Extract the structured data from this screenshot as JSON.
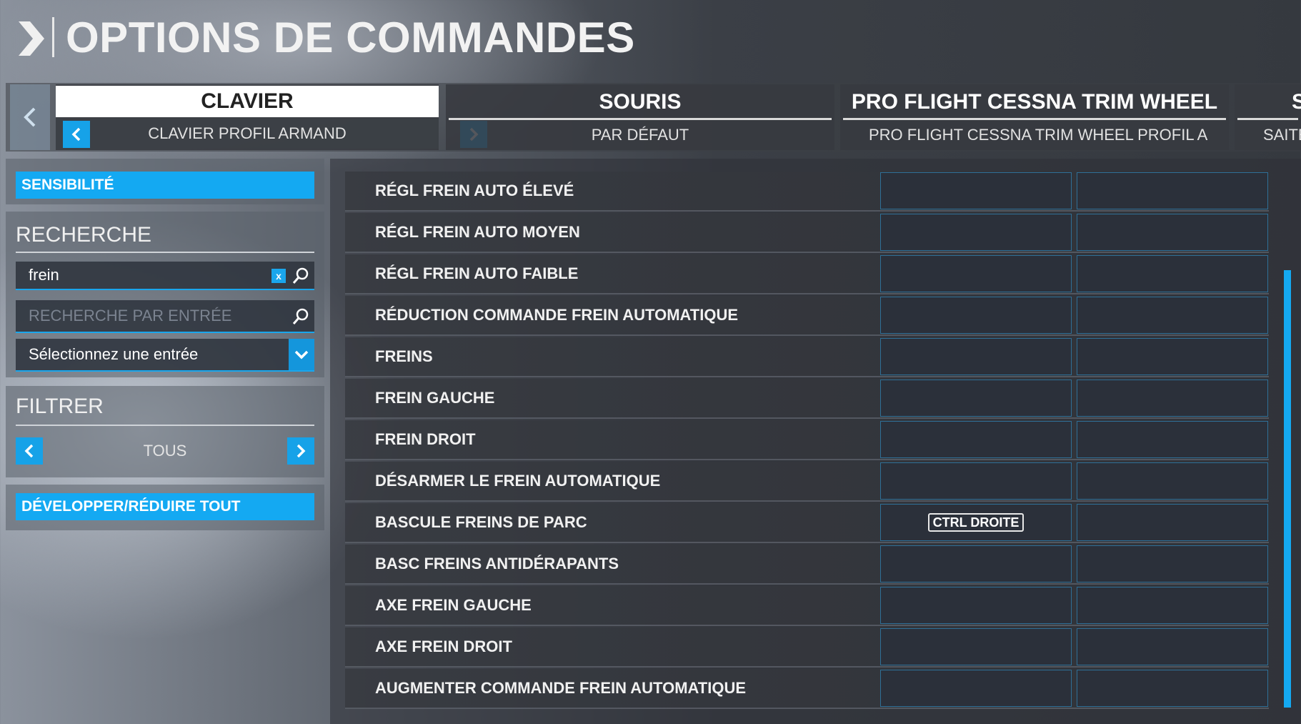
{
  "header": {
    "title": "OPTIONS DE COMMANDES"
  },
  "device_tabs": [
    {
      "name": "CLAVIER",
      "profile": "CLAVIER PROFIL ARMAND",
      "active": true
    },
    {
      "name": "SOURIS",
      "profile": "PAR DÉFAUT",
      "active": false
    },
    {
      "name": "PRO FLIGHT CESSNA TRIM WHEEL",
      "profile": "PRO FLIGHT CESSNA TRIM WHEEL PROFIL A",
      "active": false
    },
    {
      "name": "S",
      "profile": "SAITE",
      "active": false
    }
  ],
  "sidebar": {
    "sensitivity_label": "SENSIBILITÉ",
    "search": {
      "title": "RECHERCHE",
      "query_value": "frein",
      "clear_label": "x",
      "input_search_placeholder": "RECHERCHE PAR ENTRÉE",
      "select_value": "Sélectionnez une entrée"
    },
    "filter": {
      "title": "FILTRER",
      "value": "TOUS"
    },
    "expand_collapse_label": "DÉVELOPPER/RÉDUIRE TOUT"
  },
  "bindings": [
    {
      "action": "RÉGL FREIN AUTO ÉLEVÉ",
      "primary": "",
      "secondary": ""
    },
    {
      "action": "RÉGL FREIN AUTO MOYEN",
      "primary": "",
      "secondary": ""
    },
    {
      "action": "RÉGL FREIN AUTO FAIBLE",
      "primary": "",
      "secondary": ""
    },
    {
      "action": "RÉDUCTION COMMANDE FREIN AUTOMATIQUE",
      "primary": "",
      "secondary": ""
    },
    {
      "action": "FREINS",
      "primary": "",
      "secondary": ""
    },
    {
      "action": "FREIN GAUCHE",
      "primary": "",
      "secondary": ""
    },
    {
      "action": "FREIN DROIT",
      "primary": "",
      "secondary": ""
    },
    {
      "action": "DÉSARMER LE FREIN AUTOMATIQUE",
      "primary": "",
      "secondary": ""
    },
    {
      "action": "BASCULE FREINS DE PARC",
      "primary": "CTRL DROITE",
      "secondary": ""
    },
    {
      "action": "BASC FREINS ANTIDÉRAPANTS",
      "primary": "",
      "secondary": ""
    },
    {
      "action": "AXE FREIN GAUCHE",
      "primary": "",
      "secondary": ""
    },
    {
      "action": "AXE FREIN DROIT",
      "primary": "",
      "secondary": ""
    },
    {
      "action": "AUGMENTER COMMANDE FREIN AUTOMATIQUE",
      "primary": "",
      "secondary": ""
    }
  ],
  "colors": {
    "accent": "#14a9f2",
    "binding_border": "#2f6f97"
  }
}
